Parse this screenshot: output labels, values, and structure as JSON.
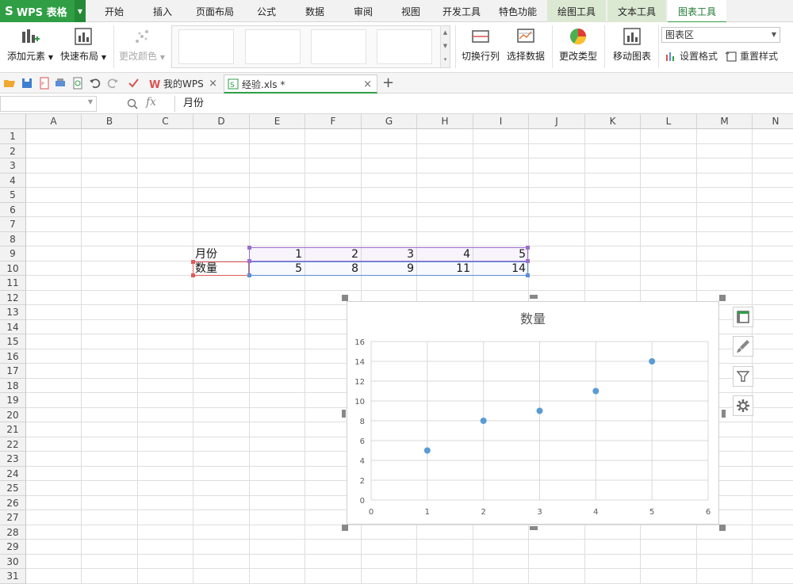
{
  "app": {
    "logo_mark": "S",
    "logo_text": "WPS 表格"
  },
  "menu_tabs": [
    "开始",
    "插入",
    "页面布局",
    "公式",
    "数据",
    "审阅",
    "视图",
    "开发工具",
    "特色功能",
    "绘图工具",
    "文本工具",
    "图表工具"
  ],
  "ribbon": {
    "add_element": "添加元素",
    "quick_layout": "快速布局",
    "change_color": "更改颜色",
    "switch_row_col": "切换行列",
    "select_data": "选择数据",
    "change_type": "更改类型",
    "move_chart": "移动图表",
    "element_select": "图表区",
    "set_format": "设置格式",
    "reset_style": "重置样式"
  },
  "doc_tabs": [
    {
      "label": "我的WPS"
    },
    {
      "label": "经验.xls *"
    }
  ],
  "formula_bar": {
    "fx": "fx",
    "content": "月份"
  },
  "columns": [
    "A",
    "B",
    "C",
    "D",
    "E",
    "F",
    "G",
    "H",
    "I",
    "J",
    "K",
    "L",
    "M",
    "N"
  ],
  "rows": [
    "1",
    "2",
    "3",
    "4",
    "5",
    "6",
    "7",
    "8",
    "9",
    "10",
    "11",
    "12",
    "13",
    "14",
    "15",
    "16",
    "17",
    "18",
    "19",
    "20",
    "21",
    "22",
    "23",
    "24",
    "25",
    "26",
    "27",
    "28",
    "29",
    "30",
    "31"
  ],
  "table": {
    "row9": {
      "label": "月份",
      "values": [
        "1",
        "2",
        "3",
        "4",
        "5"
      ]
    },
    "row10": {
      "label": "数量",
      "values": [
        "5",
        "8",
        "9",
        "11",
        "14"
      ]
    }
  },
  "chart_data": {
    "type": "scatter",
    "title": "数量",
    "x": [
      1,
      2,
      3,
      4,
      5
    ],
    "y": [
      5,
      8,
      9,
      11,
      14
    ],
    "xlim": [
      0,
      6
    ],
    "ylim": [
      0,
      16
    ],
    "xticks": [
      0,
      1,
      2,
      3,
      4,
      5,
      6
    ],
    "yticks": [
      0,
      2,
      4,
      6,
      8,
      10,
      12,
      14,
      16
    ],
    "grid": true,
    "color": "#5b9bd5"
  },
  "colors": {
    "brand": "#2f9e44",
    "x_range": "#9b6fce",
    "y_range": "#5b8fd6",
    "label_range": "#e05b5b"
  }
}
